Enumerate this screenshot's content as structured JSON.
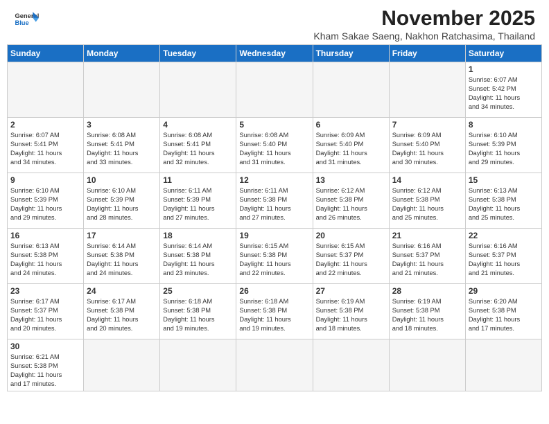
{
  "header": {
    "logo_line1": "General",
    "logo_line2": "Blue",
    "month_title": "November 2025",
    "subtitle": "Kham Sakae Saeng, Nakhon Ratchasima, Thailand"
  },
  "weekdays": [
    "Sunday",
    "Monday",
    "Tuesday",
    "Wednesday",
    "Thursday",
    "Friday",
    "Saturday"
  ],
  "weeks": [
    [
      {
        "day": "",
        "info": ""
      },
      {
        "day": "",
        "info": ""
      },
      {
        "day": "",
        "info": ""
      },
      {
        "day": "",
        "info": ""
      },
      {
        "day": "",
        "info": ""
      },
      {
        "day": "",
        "info": ""
      },
      {
        "day": "1",
        "info": "Sunrise: 6:07 AM\nSunset: 5:42 PM\nDaylight: 11 hours\nand 34 minutes."
      }
    ],
    [
      {
        "day": "2",
        "info": "Sunrise: 6:07 AM\nSunset: 5:41 PM\nDaylight: 11 hours\nand 34 minutes."
      },
      {
        "day": "3",
        "info": "Sunrise: 6:08 AM\nSunset: 5:41 PM\nDaylight: 11 hours\nand 33 minutes."
      },
      {
        "day": "4",
        "info": "Sunrise: 6:08 AM\nSunset: 5:41 PM\nDaylight: 11 hours\nand 32 minutes."
      },
      {
        "day": "5",
        "info": "Sunrise: 6:08 AM\nSunset: 5:40 PM\nDaylight: 11 hours\nand 31 minutes."
      },
      {
        "day": "6",
        "info": "Sunrise: 6:09 AM\nSunset: 5:40 PM\nDaylight: 11 hours\nand 31 minutes."
      },
      {
        "day": "7",
        "info": "Sunrise: 6:09 AM\nSunset: 5:40 PM\nDaylight: 11 hours\nand 30 minutes."
      },
      {
        "day": "8",
        "info": "Sunrise: 6:10 AM\nSunset: 5:39 PM\nDaylight: 11 hours\nand 29 minutes."
      }
    ],
    [
      {
        "day": "9",
        "info": "Sunrise: 6:10 AM\nSunset: 5:39 PM\nDaylight: 11 hours\nand 29 minutes."
      },
      {
        "day": "10",
        "info": "Sunrise: 6:10 AM\nSunset: 5:39 PM\nDaylight: 11 hours\nand 28 minutes."
      },
      {
        "day": "11",
        "info": "Sunrise: 6:11 AM\nSunset: 5:39 PM\nDaylight: 11 hours\nand 27 minutes."
      },
      {
        "day": "12",
        "info": "Sunrise: 6:11 AM\nSunset: 5:38 PM\nDaylight: 11 hours\nand 27 minutes."
      },
      {
        "day": "13",
        "info": "Sunrise: 6:12 AM\nSunset: 5:38 PM\nDaylight: 11 hours\nand 26 minutes."
      },
      {
        "day": "14",
        "info": "Sunrise: 6:12 AM\nSunset: 5:38 PM\nDaylight: 11 hours\nand 25 minutes."
      },
      {
        "day": "15",
        "info": "Sunrise: 6:13 AM\nSunset: 5:38 PM\nDaylight: 11 hours\nand 25 minutes."
      }
    ],
    [
      {
        "day": "16",
        "info": "Sunrise: 6:13 AM\nSunset: 5:38 PM\nDaylight: 11 hours\nand 24 minutes."
      },
      {
        "day": "17",
        "info": "Sunrise: 6:14 AM\nSunset: 5:38 PM\nDaylight: 11 hours\nand 24 minutes."
      },
      {
        "day": "18",
        "info": "Sunrise: 6:14 AM\nSunset: 5:38 PM\nDaylight: 11 hours\nand 23 minutes."
      },
      {
        "day": "19",
        "info": "Sunrise: 6:15 AM\nSunset: 5:38 PM\nDaylight: 11 hours\nand 22 minutes."
      },
      {
        "day": "20",
        "info": "Sunrise: 6:15 AM\nSunset: 5:37 PM\nDaylight: 11 hours\nand 22 minutes."
      },
      {
        "day": "21",
        "info": "Sunrise: 6:16 AM\nSunset: 5:37 PM\nDaylight: 11 hours\nand 21 minutes."
      },
      {
        "day": "22",
        "info": "Sunrise: 6:16 AM\nSunset: 5:37 PM\nDaylight: 11 hours\nand 21 minutes."
      }
    ],
    [
      {
        "day": "23",
        "info": "Sunrise: 6:17 AM\nSunset: 5:37 PM\nDaylight: 11 hours\nand 20 minutes."
      },
      {
        "day": "24",
        "info": "Sunrise: 6:17 AM\nSunset: 5:38 PM\nDaylight: 11 hours\nand 20 minutes."
      },
      {
        "day": "25",
        "info": "Sunrise: 6:18 AM\nSunset: 5:38 PM\nDaylight: 11 hours\nand 19 minutes."
      },
      {
        "day": "26",
        "info": "Sunrise: 6:18 AM\nSunset: 5:38 PM\nDaylight: 11 hours\nand 19 minutes."
      },
      {
        "day": "27",
        "info": "Sunrise: 6:19 AM\nSunset: 5:38 PM\nDaylight: 11 hours\nand 18 minutes."
      },
      {
        "day": "28",
        "info": "Sunrise: 6:19 AM\nSunset: 5:38 PM\nDaylight: 11 hours\nand 18 minutes."
      },
      {
        "day": "29",
        "info": "Sunrise: 6:20 AM\nSunset: 5:38 PM\nDaylight: 11 hours\nand 17 minutes."
      }
    ],
    [
      {
        "day": "30",
        "info": "Sunrise: 6:21 AM\nSunset: 5:38 PM\nDaylight: 11 hours\nand 17 minutes."
      },
      {
        "day": "",
        "info": ""
      },
      {
        "day": "",
        "info": ""
      },
      {
        "day": "",
        "info": ""
      },
      {
        "day": "",
        "info": ""
      },
      {
        "day": "",
        "info": ""
      },
      {
        "day": "",
        "info": ""
      }
    ]
  ]
}
